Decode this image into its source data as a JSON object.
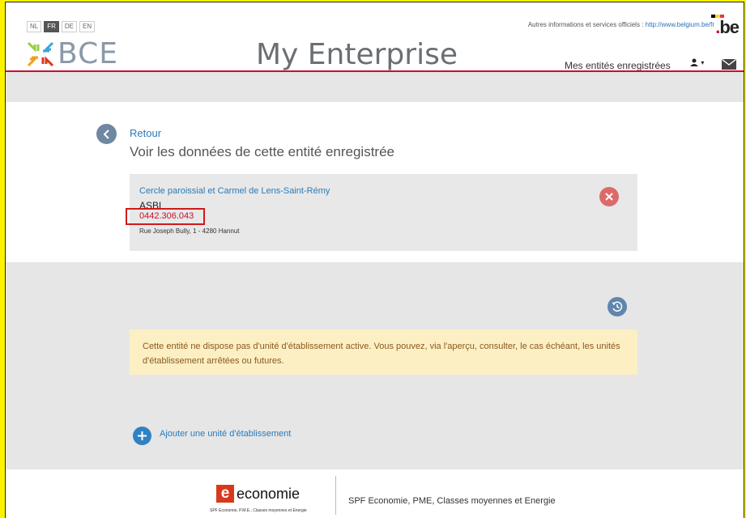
{
  "header": {
    "languages": [
      "NL",
      "FR",
      "DE",
      "EN"
    ],
    "active_language": "FR",
    "logo_text": "BCE",
    "app_title": "My Enterprise",
    "official_text": "Autres informations et services officiels :",
    "official_link": "http://www.belgium.be/fr",
    "be_logo": "be",
    "nav_registered": "Mes entités enregistrées",
    "user_menu_caret": "▾"
  },
  "main": {
    "back_label": "Retour",
    "page_title": "Voir les données de cette entité enregistrée",
    "entity": {
      "name": "Cercle paroissial et Carmel de Lens-Saint-Rémy",
      "legal_form": "ASBL",
      "number": "0442.306.043",
      "address": "Rue Joseph Bully, 1 - 4280 Hannut"
    },
    "alert_text": "Cette entité ne dispose pas d'unité d'établissement active. Vous pouvez, via l'aperçu, consulter, le cas échéant, les unités d'établissement arrêtées ou futures.",
    "add_unit_label": "Ajouter une unité d'établissement"
  },
  "footer": {
    "eco_logo_text": "economie",
    "eco_logo_sub": "SPF Economie, P.M.E., Classes moyennes et Energie",
    "org_name": "SPF Economie, PME, Classes moyennes et Energie"
  },
  "icons": {
    "back": "chevron-left-icon",
    "close": "close-icon",
    "history": "history-icon",
    "add": "plus-icon",
    "user": "user-icon",
    "mail": "mail-icon"
  },
  "colors": {
    "brand_red": "#c8102e",
    "link_blue": "#2a7ab8",
    "highlight": "#FDF200",
    "alert_bg": "#fcefc4"
  }
}
